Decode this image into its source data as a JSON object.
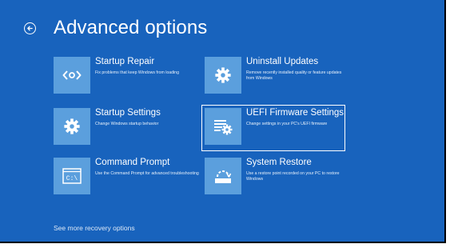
{
  "header": {
    "title": "Advanced options"
  },
  "options": [
    {
      "title": "Startup Repair",
      "description": "Fix problems that keep Windows from loading",
      "icon": "startup-repair-icon"
    },
    {
      "title": "Uninstall Updates",
      "description": "Remove recently installed quality or feature updates from Windows",
      "icon": "gear-icon"
    },
    {
      "title": "Startup Settings",
      "description": "Change Windows startup behavior",
      "icon": "gear-icon"
    },
    {
      "title": "UEFI Firmware Settings",
      "description": "Change settings in your PC's UEFI firmware",
      "icon": "firmware-chip-icon"
    },
    {
      "title": "Command Prompt",
      "description": "Use the Command Prompt for advanced troubleshooting",
      "icon": "command-prompt-icon"
    },
    {
      "title": "System Restore",
      "description": "Use a restore point recorded on your PC to restore Windows",
      "icon": "system-restore-icon"
    }
  ],
  "footer": {
    "more_link": "See more recovery options"
  },
  "colors": {
    "background": "#1863bd",
    "tile": "#5b9fdd",
    "text": "#ffffff",
    "selected_border": "#ffffff"
  },
  "selected_option": "UEFI Firmware Settings"
}
